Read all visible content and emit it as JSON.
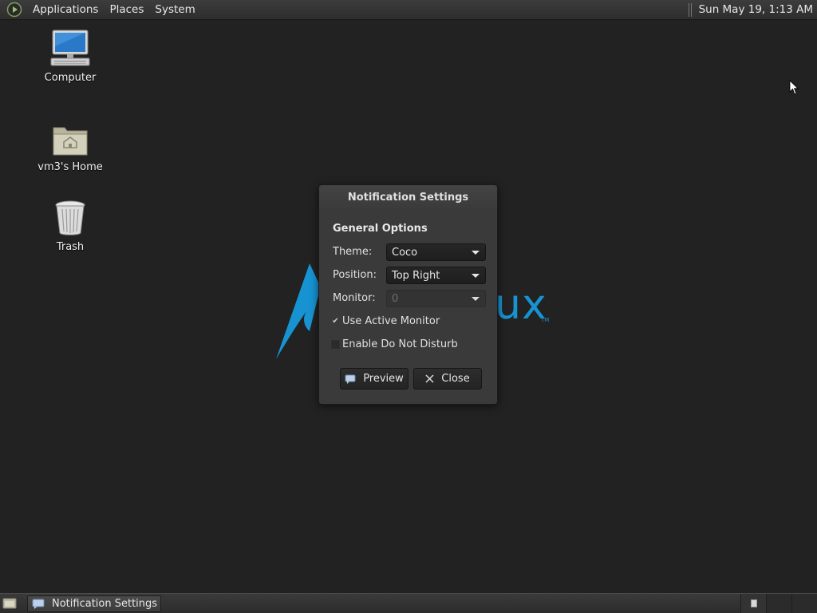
{
  "top_panel": {
    "menus": [
      "Applications",
      "Places",
      "System"
    ],
    "clock": "Sun May 19,  1:13 AM"
  },
  "desktop_icons": [
    {
      "label": "Computer",
      "icon": "computer-icon"
    },
    {
      "label": "vm3's Home",
      "icon": "home-folder-icon"
    },
    {
      "label": "Trash",
      "icon": "trash-icon"
    }
  ],
  "wallpaper": {
    "text": "ux",
    "tm": "TM",
    "color": "#1793d1"
  },
  "dialog": {
    "title": "Notification Settings",
    "section_title": "General Options",
    "theme": {
      "label": "Theme:",
      "value": "Coco"
    },
    "position": {
      "label": "Position:",
      "value": "Top Right"
    },
    "monitor": {
      "label": "Monitor:",
      "value": "0"
    },
    "use_active_monitor": {
      "label": "Use Active Monitor",
      "checked": true
    },
    "do_not_disturb": {
      "label": "Enable Do Not Disturb",
      "checked": false
    },
    "preview_label": "Preview",
    "close_label": "Close"
  },
  "bottom_panel": {
    "task_label": "Notification Settings"
  }
}
